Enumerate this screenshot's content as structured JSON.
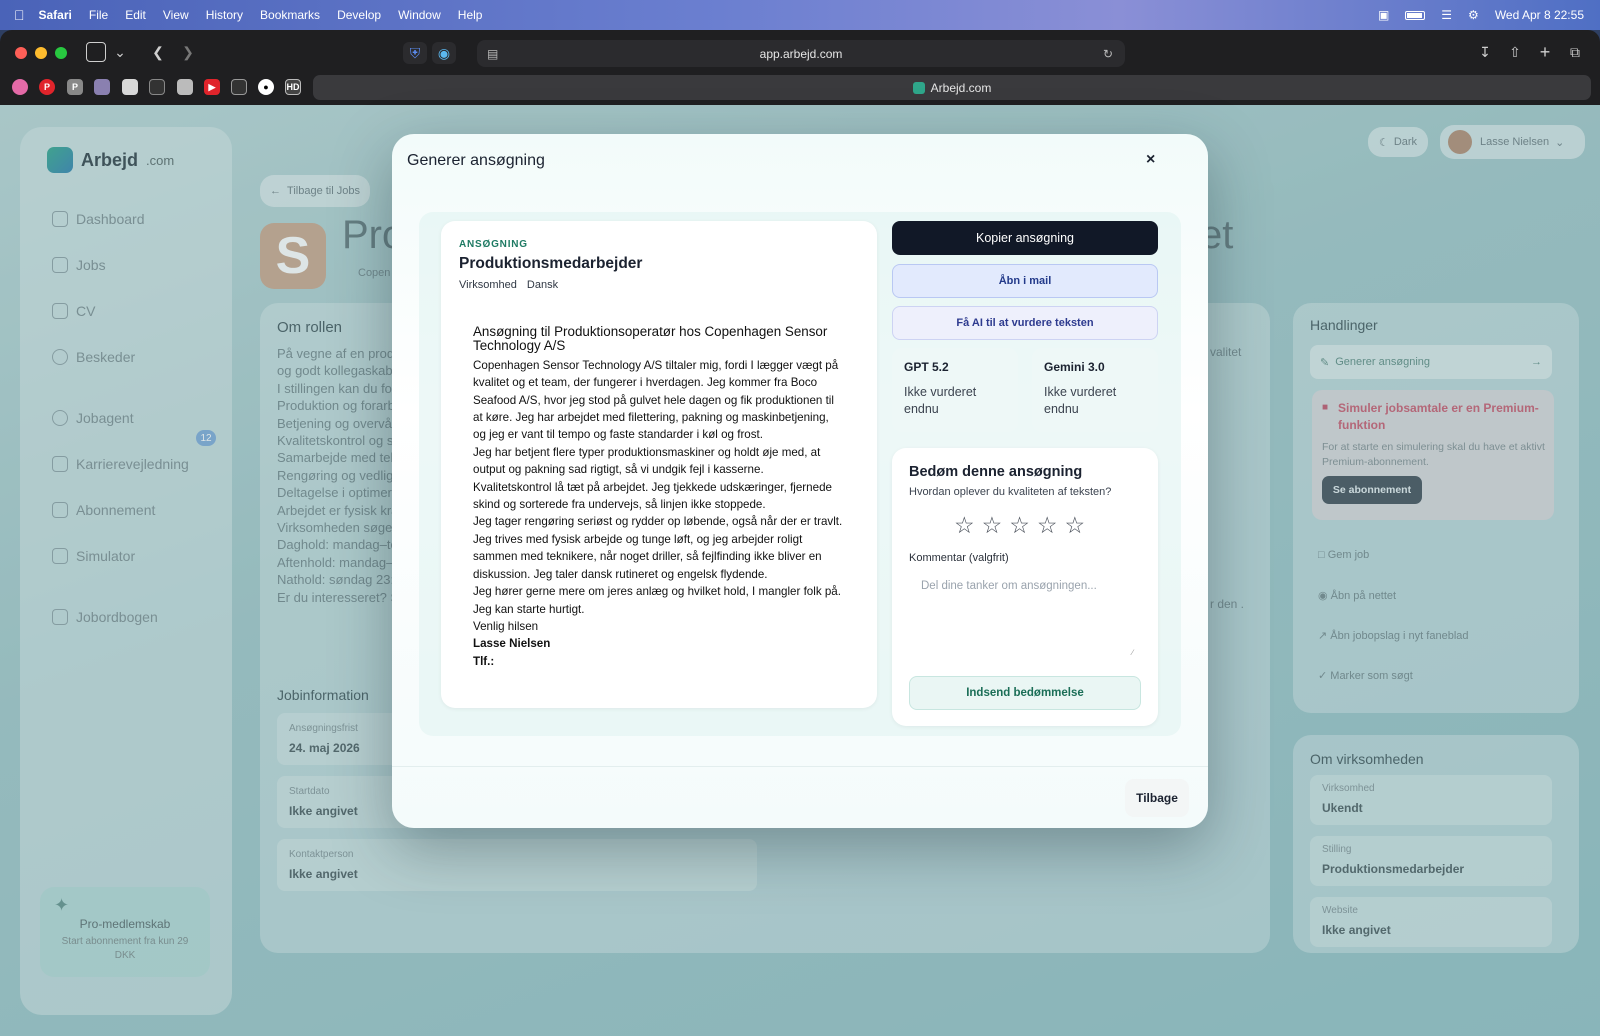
{
  "menubar": {
    "app": "Safari",
    "items": [
      "File",
      "Edit",
      "View",
      "History",
      "Bookmarks",
      "Develop",
      "Window",
      "Help"
    ],
    "clock": "Wed Apr 8  22:55"
  },
  "browser": {
    "url": "app.arbejd.com",
    "tab_title": "Arbejd.com"
  },
  "sidebar": {
    "brand": "Arbejd",
    "brand_suffix": ".com",
    "nav": [
      "Dashboard",
      "Jobs",
      "CV",
      "Beskeder",
      "Jobagent",
      "Karrierevejledning",
      "Abonnement",
      "Simulator",
      "Jobordbogen"
    ],
    "jobagent_badge": "12",
    "pro_title": "Pro-medlemskab",
    "pro_sub": "Start abonnement fra kun 29 DKK"
  },
  "header": {
    "theme_toggle": "Dark",
    "user_name": "Lasse Nielsen",
    "back_link": "Tilbage til Jobs",
    "job_title_start": "Pro",
    "job_title_end": "et",
    "company_partial": "Copen"
  },
  "background": {
    "about_role": "Om rollen",
    "role_lines": [
      "På vegne af en prod",
      "og godt kollegaskab",
      "I stillingen kan du fo",
      "Produktion og forarb",
      "Betjening og overvåg",
      "Kvalitetskontrol og s",
      "Samarbejde med tek",
      "Rengøring og vedlig",
      "Deltagelse i optimeri",
      "Arbejdet er fysisk kra",
      "Virksomheden søger",
      "Daghold: mandag–to",
      "Aftenhold: mandag–",
      "Nathold: søndag 23:",
      "Er du interesseret? S"
    ],
    "right_fragment_1": "valitet",
    "right_fragment_2": "r den .",
    "job_info": "Jobinformation",
    "fields": [
      {
        "label": "Ansøgningsfrist",
        "value": "24. maj 2026"
      },
      {
        "label": "Startdato",
        "value": "Ikke angivet"
      },
      {
        "label": "Kontaktperson",
        "value": "Ikke angivet"
      }
    ],
    "actions_title": "Handlinger",
    "generate_action": "Generer ansøgning",
    "premium_title": "Simuler jobsamtale er en Premium-funktion",
    "premium_text": "For at starte en simulering skal du have et aktivt Premium-abonnement.",
    "premium_button": "Se abonnement",
    "links": [
      "Gem job",
      "Åbn på nettet",
      "Åbn jobopslag i nyt faneblad",
      "Marker som søgt"
    ],
    "company_title": "Om virksomheden",
    "company_fields": [
      {
        "label": "Virksomhed",
        "value": "Ukendt"
      },
      {
        "label": "Stilling",
        "value": "Produktionsmedarbejder"
      },
      {
        "label": "Website",
        "value": "Ikke angivet"
      }
    ]
  },
  "modal": {
    "title": "Generer ansøgning",
    "close": "×",
    "letter": {
      "label": "ANSØGNING",
      "title": "Produktionsmedarbejder",
      "meta": [
        "Virksomhed",
        "Dansk"
      ],
      "heading": "Ansøgning til Produktionsoperatør hos Copenhagen Sensor Technology A/S",
      "lines": [
        "Copenhagen Sensor Technology A/S tiltaler mig, fordi I lægger vægt på",
        "kvalitet og et team, der fungerer i hverdagen. Jeg kommer fra Boco",
        "Seafood A/S, hvor jeg stod på gulvet hele dagen og fik produktionen til",
        "at køre. Jeg har arbejdet med filettering, pakning og maskinbetjening,",
        "og jeg er vant til tempo og faste standarder i køl og frost.",
        "Jeg har betjent flere typer produktionsmaskiner og holdt øje med, at",
        "output og pakning sad rigtigt, så vi undgik fejl i kasserne.",
        "Kvalitetskontrol lå tæt på arbejdet. Jeg tjekkede udskæringer, fjernede",
        "skind og sorterede fra undervejs, så linjen ikke stoppede.",
        "Jeg tager rengøring seriøst og rydder op løbende, også når der er travlt.",
        "Jeg trives med fysisk arbejde og tunge løft, og jeg arbejder roligt",
        "sammen med teknikere, når noget driller, så fejlfinding ikke bliver en",
        "diskussion. Jeg taler dansk rutineret og engelsk flydende.",
        "Jeg hører gerne mere om jeres anlæg og hvilket hold, I mangler folk på.",
        "Jeg kan starte hurtigt.",
        "Venlig hilsen"
      ],
      "signature": "Lasse Nielsen",
      "phone_label": "Tlf.:"
    },
    "copy_button": "Kopier ansøgning",
    "mail_button": "Åbn i mail",
    "ai_button": "Få AI til at vurdere teksten",
    "models": [
      {
        "name": "GPT 5.2",
        "status": "Ikke vurderet endnu"
      },
      {
        "name": "Gemini 3.0",
        "status": "Ikke vurderet endnu"
      }
    ],
    "rating": {
      "title": "Bedøm denne ansøgning",
      "question": "Hvordan oplever du kvaliteten af teksten?",
      "stars": 0,
      "comment_label": "Kommentar (valgfrit)",
      "comment_placeholder": "Del dine tanker om ansøgningen...",
      "submit": "Indsend bedømmelse"
    },
    "back_button": "Tilbage"
  },
  "colors": {
    "accent_green": "#1e7a63",
    "dark_button": "#111827",
    "premium_red": "#d0405a"
  }
}
